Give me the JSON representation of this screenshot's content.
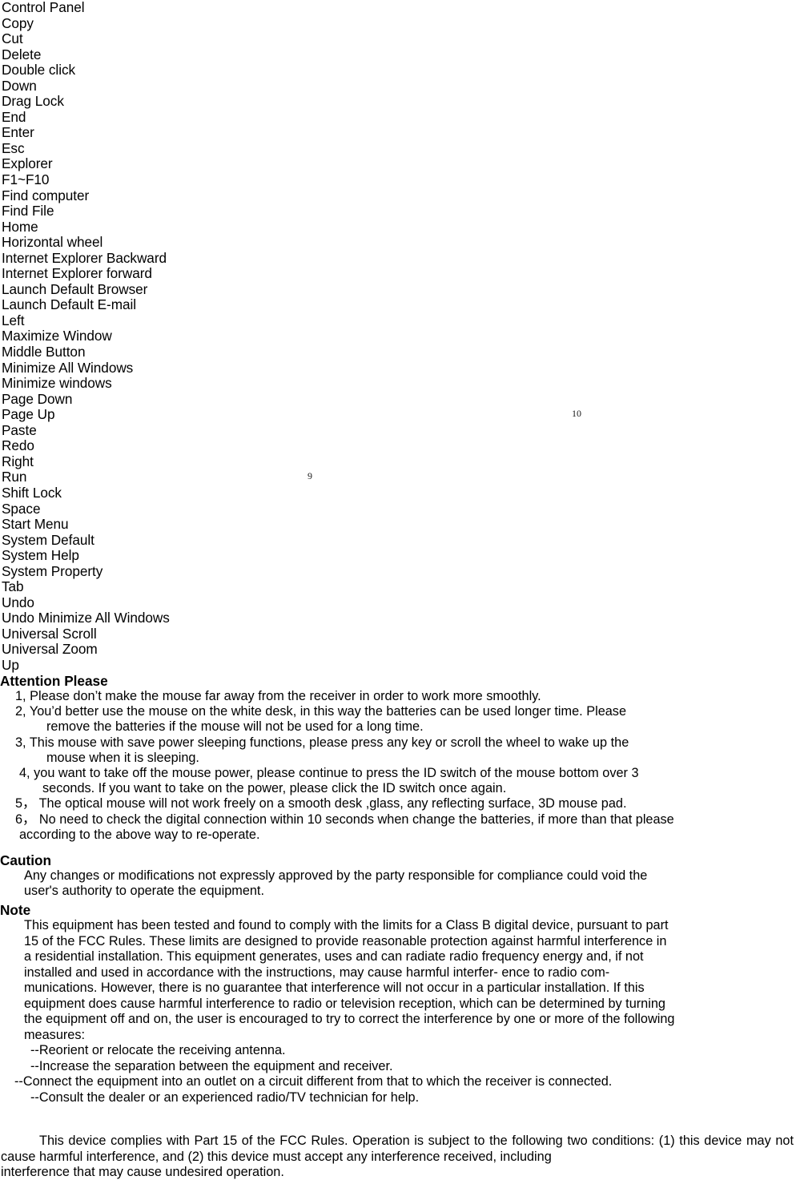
{
  "document": {
    "type": "product-manual-page",
    "page_number_marks": [
      {
        "label": "10"
      },
      {
        "label": "9"
      }
    ]
  },
  "shortcut_list": {
    "items": [
      "Control Panel",
      "Copy",
      "Cut",
      "Delete",
      "Double click",
      "Down",
      "Drag Lock",
      "End",
      "Enter",
      "Esc",
      "Explorer",
      "F1~F10",
      "Find computer",
      "Find File",
      "Home",
      "Horizontal wheel",
      "Internet Explorer Backward",
      "Internet Explorer forward",
      "Launch Default Browser",
      "Launch Default E-mail",
      "Left",
      "Maximize Window",
      "Middle Button",
      "Minimize All Windows",
      "Minimize windows",
      "Page Down",
      "Page Up",
      "Paste",
      "Redo",
      "Right",
      "Run",
      "Shift Lock",
      "Space",
      "Start Menu",
      "System Default",
      "System Help",
      "System Property",
      "Tab",
      "Undo",
      "Undo Minimize All Windows",
      "Universal Scroll",
      "Universal Zoom",
      "Up"
    ]
  },
  "attention": {
    "heading": "Attention Please",
    "items": [
      {
        "num": "1,",
        "text": "Please don’t make the mouse far away from the receiver in order to work more smoothly."
      },
      {
        "num": "2,",
        "text": "You’d better use the mouse on the white desk, in this way the batteries can be used longer time. Please",
        "cont": "remove the batteries if the mouse will not be used for a long time."
      },
      {
        "num": "3,",
        "text": "This mouse with save power sleeping functions, please press any key or scroll the wheel to wake up the",
        "cont": "mouse when it is sleeping."
      },
      {
        "num": "4,",
        "text": "you want to take off the mouse power, please continue to press the ID switch of the mouse bottom over 3",
        "cont": "seconds. If you want to take on the power, please click the ID switch once again."
      },
      {
        "num": "5，",
        "text": "The optical mouse will not work freely on a smooth desk ,glass, any reflecting surface, 3D mouse pad."
      },
      {
        "num": "6，",
        "text": "No need to check the digital connection within 10 seconds when change the batteries, if more than that please",
        "cont": "according to the above way to re-operate."
      }
    ]
  },
  "caution": {
    "heading": "Caution",
    "body": "Any changes or modifications not expressly approved by the party responsible for compliance could void the",
    "body_lastline": "user's authority to operate the equipment."
  },
  "note": {
    "heading": "Note",
    "lines": [
      "This equipment has been tested and found to comply with the limits for a Class B digital device, pursuant to part",
      "15 of the FCC Rules. These limits are designed to provide reasonable protection against harmful interference in",
      "a residential installation. This equipment generates, uses and can radiate radio frequency energy and, if not",
      "installed and used in accordance with the instructions, may cause harmful interfer- ence to radio com-",
      "munications. However, there is no guarantee that interference will not occur in a particular installation. If this",
      "equipment does cause harmful interference to radio or television reception, which can be determined by turning",
      "the equipment off and on, the user is encouraged to try to correct the interference by one or more of the following",
      "measures:"
    ],
    "measures": [
      "--Reorient or relocate the receiving antenna.",
      "--Increase the separation between the equipment and receiver.",
      "--Connect the equipment into an outlet on a circuit different from that to which the receiver is connected.",
      "--Consult the dealer or an experienced radio/TV technician for help."
    ]
  },
  "fcc_statement": {
    "text": "This device complies with Part 15 of the FCC Rules. Operation is subject to the following two conditions: (1) this device may not cause harmful interference, and (2) this device must accept any interference received, including",
    "lastline": "interference that may cause undesired operation."
  }
}
